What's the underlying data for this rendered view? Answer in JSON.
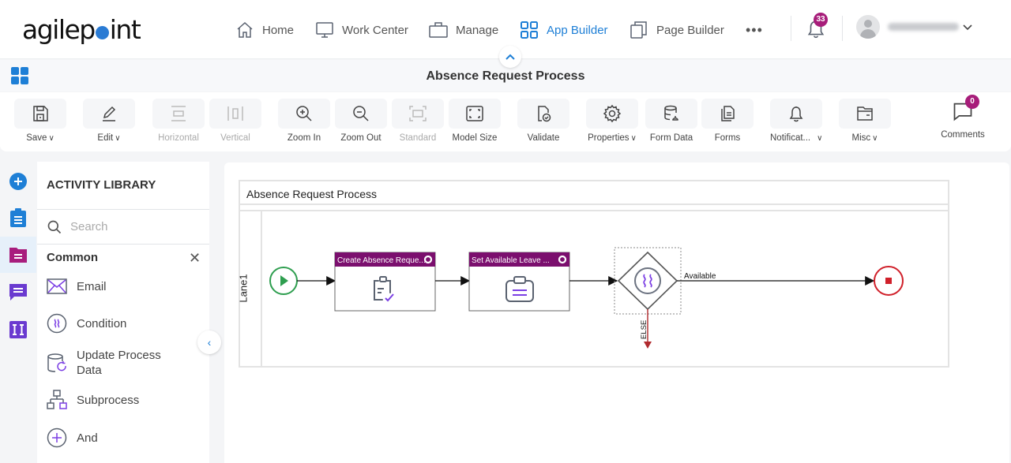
{
  "app": {
    "logo_text_before": "agilep",
    "logo_text_after": "int"
  },
  "nav": {
    "items": [
      {
        "label": "Home",
        "icon": "home-icon",
        "active": false
      },
      {
        "label": "Work Center",
        "icon": "monitor-icon",
        "active": false
      },
      {
        "label": "Manage",
        "icon": "briefcase-icon",
        "active": false
      },
      {
        "label": "App Builder",
        "icon": "grid-icon",
        "active": true
      },
      {
        "label": "Page Builder",
        "icon": "pages-icon",
        "active": false
      }
    ],
    "more_label": "•••",
    "notifications_count": "33",
    "user_chevron": "⌄",
    "collapse_label": "^"
  },
  "titlebar": {
    "title": "Absence Request Process"
  },
  "toolbar": {
    "buttons": [
      {
        "label": "Save",
        "dropdown": true,
        "disabled": false
      },
      {
        "label": "Edit",
        "dropdown": true,
        "disabled": false
      },
      {
        "label": "Horizontal",
        "dropdown": false,
        "disabled": true
      },
      {
        "label": "Vertical",
        "dropdown": false,
        "disabled": true
      },
      {
        "label": "Zoom In",
        "dropdown": false,
        "disabled": false
      },
      {
        "label": "Zoom Out",
        "dropdown": false,
        "disabled": false
      },
      {
        "label": "Standard",
        "dropdown": false,
        "disabled": true
      },
      {
        "label": "Model Size",
        "dropdown": false,
        "disabled": false
      },
      {
        "label": "Validate",
        "dropdown": false,
        "disabled": false
      },
      {
        "label": "Properties",
        "dropdown": true,
        "disabled": false
      },
      {
        "label": "Form Data",
        "dropdown": false,
        "disabled": false
      },
      {
        "label": "Forms",
        "dropdown": false,
        "disabled": false
      },
      {
        "label": "Notificat...",
        "dropdown": true,
        "disabled": false
      },
      {
        "label": "Misc",
        "dropdown": true,
        "disabled": false
      }
    ],
    "comments": {
      "label": "Comments",
      "count": "0"
    },
    "chevron": "∨"
  },
  "library": {
    "title": "ACTIVITY LIBRARY",
    "search_placeholder": "Search",
    "search_value": "",
    "category": "Common",
    "close_label": "✕",
    "toggle_label": "‹",
    "items": [
      {
        "label": "Email",
        "icon": "email-icon"
      },
      {
        "label": "Condition",
        "icon": "condition-icon"
      },
      {
        "label": "Update Process Data",
        "icon": "update-process-data-icon"
      },
      {
        "label": "Subprocess",
        "icon": "subprocess-icon"
      },
      {
        "label": "And",
        "icon": "and-icon"
      }
    ]
  },
  "diagram": {
    "pool_title": "Absence Request Process",
    "lane_label": "Lane1",
    "tasks": [
      {
        "title": "Create Absence Reque...",
        "icon": "form-check-icon"
      },
      {
        "title": "Set Available Leave ...",
        "icon": "clipboard-icon"
      }
    ],
    "gateway_outgoing_label": "Available",
    "gateway_else_label": "ELSE",
    "colors": {
      "task_header": "#7b0f6e",
      "start": "#2e9e4f",
      "end": "#d0202a",
      "accent": "#1e7fd6",
      "icon_purple": "#7b3fe4"
    }
  }
}
